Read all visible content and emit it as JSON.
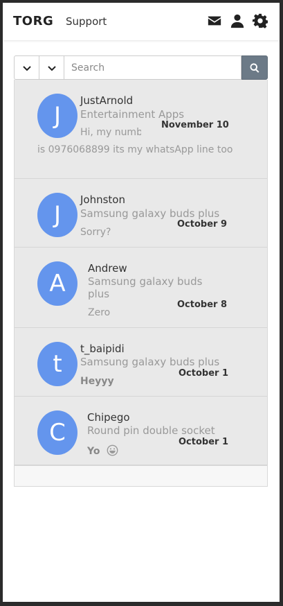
{
  "navbar": {
    "brand": "TORG",
    "support_link": "Support",
    "icons": [
      "envelope-icon",
      "user-icon",
      "gear-icon"
    ]
  },
  "search": {
    "placeholder": "Search",
    "select1_value": "",
    "select2_value": ""
  },
  "colors": {
    "avatar_bg": "#6495ed",
    "item_bg": "#e9e9e9",
    "search_button": "#6c7a87"
  },
  "conversations": [
    {
      "initial": "J",
      "name": "JustArnold",
      "subject": "Entertainment Apps",
      "date": "November 10",
      "preview": "Hi, my number is 0976068899 its my whatsApp line too"
    },
    {
      "initial": "J",
      "name": "Johnston",
      "subject": "Samsung galaxy buds plus",
      "date": "October 9",
      "preview": "Sorry?"
    },
    {
      "initial": "A",
      "name": "Andrew",
      "subject": "Samsung galaxy buds plus",
      "date": "October 8",
      "preview": "Zero"
    },
    {
      "initial": "t",
      "name": "t_baipidi",
      "subject": "Samsung galaxy buds plus",
      "date": "October 1",
      "preview": "Heyyy"
    },
    {
      "initial": "C",
      "name": "Chipego",
      "subject": "Round pin double socket",
      "date": "October 1",
      "preview": "Yo"
    }
  ]
}
